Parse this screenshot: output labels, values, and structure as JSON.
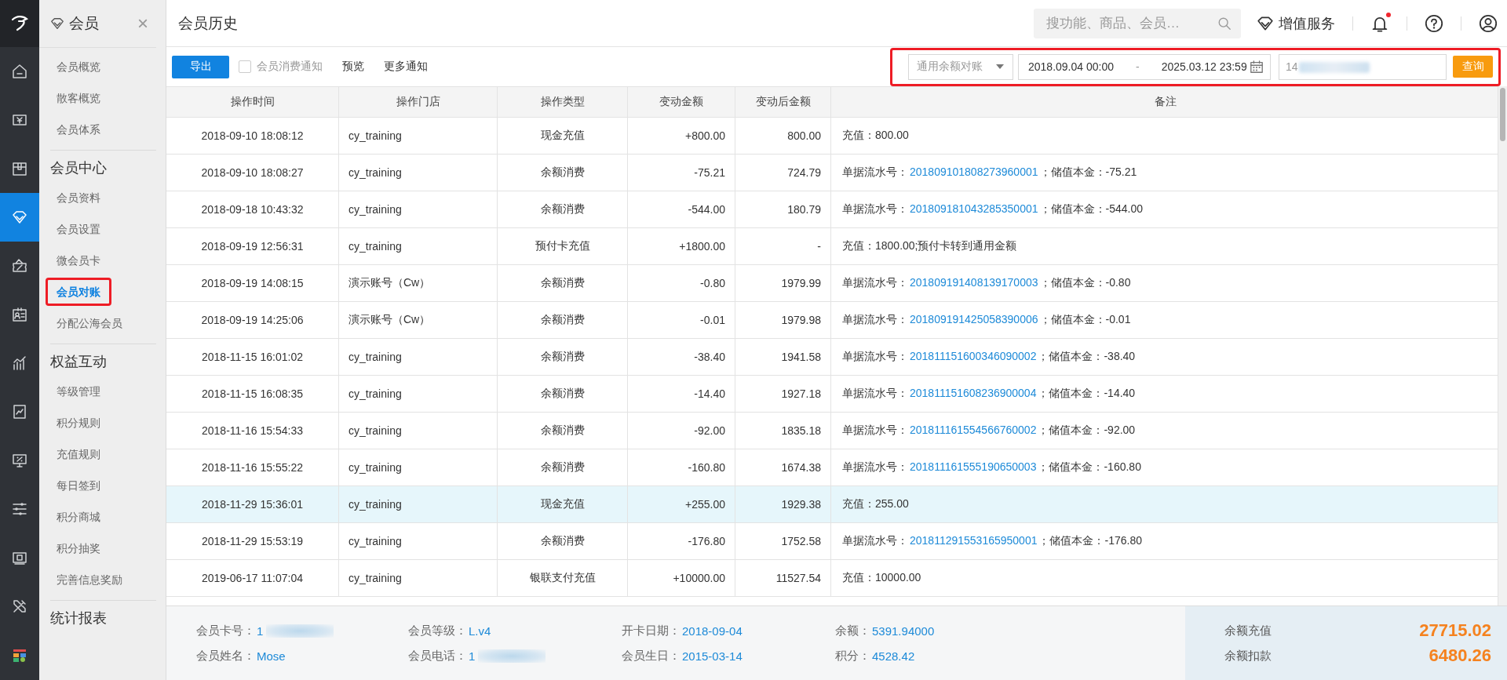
{
  "rail": {
    "items": [
      {
        "selected": false
      },
      {
        "selected": false
      },
      {
        "selected": false
      },
      {
        "selected": true
      },
      {
        "selected": false
      },
      {
        "selected": false
      },
      {
        "selected": false
      },
      {
        "selected": false
      },
      {
        "selected": false
      },
      {
        "selected": false
      },
      {
        "selected": false
      },
      {
        "selected": false
      },
      {
        "selected": false
      }
    ]
  },
  "sidebar": {
    "title": "会员",
    "close": "×",
    "groups": [
      {
        "items": [
          {
            "label": "会员概览",
            "selected": false,
            "highlighted": false
          },
          {
            "label": "散客概览",
            "selected": false,
            "highlighted": false
          },
          {
            "label": "会员体系",
            "selected": false,
            "highlighted": false
          }
        ]
      },
      {
        "heading": "会员中心",
        "items": [
          {
            "label": "会员资料",
            "selected": false,
            "highlighted": false
          },
          {
            "label": "会员设置",
            "selected": false,
            "highlighted": false
          },
          {
            "label": "微会员卡",
            "selected": false,
            "highlighted": false
          },
          {
            "label": "会员对账",
            "selected": true,
            "highlighted": true
          },
          {
            "label": "分配公海会员",
            "selected": false,
            "highlighted": false
          }
        ]
      },
      {
        "heading": "权益互动",
        "items": [
          {
            "label": "等级管理",
            "selected": false,
            "highlighted": false
          },
          {
            "label": "积分规则",
            "selected": false,
            "highlighted": false
          },
          {
            "label": "充值规则",
            "selected": false,
            "highlighted": false
          },
          {
            "label": "每日签到",
            "selected": false,
            "highlighted": false
          },
          {
            "label": "积分商城",
            "selected": false,
            "highlighted": false
          },
          {
            "label": "积分抽奖",
            "selected": false,
            "highlighted": false
          },
          {
            "label": "完善信息奖励",
            "selected": false,
            "highlighted": false
          }
        ]
      },
      {
        "heading": "统计报表"
      }
    ]
  },
  "header": {
    "title": "会员历史",
    "search": {
      "placeholder": "搜功能、商品、会员…"
    },
    "value_added": "增值服务",
    "notification_dot": true
  },
  "toolbar": {
    "export": "导出",
    "notify": {
      "label": "会员消费通知",
      "checked": false
    },
    "links": [
      "预览",
      "更多通知"
    ]
  },
  "filter": {
    "highlighted": true,
    "type": "通用余额对账",
    "date_from": "2018.09.04 00:00",
    "date_sep": "-",
    "date_to": "2025.03.12 23:59",
    "member": {
      "value": "14",
      "redacted": true
    },
    "query": "查询"
  },
  "table": {
    "columns": [
      "操作时间",
      "操作门店",
      "操作类型",
      "变动金额",
      "变动后金额",
      "备注"
    ],
    "rows": [
      {
        "selected": false,
        "cells": [
          "2018-09-10 18:08:12",
          "cy_training",
          "现金充值",
          "+800.00",
          "800.00"
        ],
        "remark": {
          "kind": "text",
          "text": "充值：800.00"
        }
      },
      {
        "selected": false,
        "cells": [
          "2018-09-10 18:08:27",
          "cy_training",
          "余额消费",
          "-75.21",
          "724.79"
        ],
        "remark": {
          "kind": "order",
          "label": "单据流水号：",
          "order_no": "201809101808273960001",
          "tail": "；储值本金：-75.21"
        }
      },
      {
        "selected": false,
        "cells": [
          "2018-09-18 10:43:32",
          "cy_training",
          "余额消费",
          "-544.00",
          "180.79"
        ],
        "remark": {
          "kind": "order",
          "label": "单据流水号：",
          "order_no": "201809181043285350001",
          "tail": "；储值本金：-544.00"
        }
      },
      {
        "selected": false,
        "cells": [
          "2018-09-19 12:56:31",
          "cy_training",
          "预付卡充值",
          "+1800.00",
          "-"
        ],
        "remark": {
          "kind": "text",
          "text": "充值：1800.00;预付卡转到通用金额"
        }
      },
      {
        "selected": false,
        "cells": [
          "2018-09-19 14:08:15",
          "演示账号（Cw）",
          "余额消费",
          "-0.80",
          "1979.99"
        ],
        "remark": {
          "kind": "order",
          "label": "单据流水号：",
          "order_no": "201809191408139170003",
          "tail": "；储值本金：-0.80"
        }
      },
      {
        "selected": false,
        "cells": [
          "2018-09-19 14:25:06",
          "演示账号（Cw）",
          "余额消费",
          "-0.01",
          "1979.98"
        ],
        "remark": {
          "kind": "order",
          "label": "单据流水号：",
          "order_no": "201809191425058390006",
          "tail": "；储值本金：-0.01"
        }
      },
      {
        "selected": false,
        "cells": [
          "2018-11-15 16:01:02",
          "cy_training",
          "余额消费",
          "-38.40",
          "1941.58"
        ],
        "remark": {
          "kind": "order",
          "label": "单据流水号：",
          "order_no": "201811151600346090002",
          "tail": "；储值本金：-38.40"
        }
      },
      {
        "selected": false,
        "cells": [
          "2018-11-15 16:08:35",
          "cy_training",
          "余额消费",
          "-14.40",
          "1927.18"
        ],
        "remark": {
          "kind": "order",
          "label": "单据流水号：",
          "order_no": "201811151608236900004",
          "tail": "；储值本金：-14.40"
        }
      },
      {
        "selected": false,
        "cells": [
          "2018-11-16 15:54:33",
          "cy_training",
          "余额消费",
          "-92.00",
          "1835.18"
        ],
        "remark": {
          "kind": "order",
          "label": "单据流水号：",
          "order_no": "201811161554566760002",
          "tail": "；储值本金：-92.00"
        }
      },
      {
        "selected": false,
        "cells": [
          "2018-11-16 15:55:22",
          "cy_training",
          "余额消费",
          "-160.80",
          "1674.38"
        ],
        "remark": {
          "kind": "order",
          "label": "单据流水号：",
          "order_no": "201811161555190650003",
          "tail": "；储值本金：-160.80"
        }
      },
      {
        "selected": true,
        "cells": [
          "2018-11-29 15:36:01",
          "cy_training",
          "现金充值",
          "+255.00",
          "1929.38"
        ],
        "remark": {
          "kind": "text",
          "text": "充值：255.00"
        }
      },
      {
        "selected": false,
        "cells": [
          "2018-11-29 15:53:19",
          "cy_training",
          "余额消费",
          "-176.80",
          "1752.58"
        ],
        "remark": {
          "kind": "order",
          "label": "单据流水号：",
          "order_no": "201811291553165950001",
          "tail": "；储值本金：-176.80"
        }
      },
      {
        "selected": false,
        "cells": [
          "2019-06-17 11:07:04",
          "cy_training",
          "银联支付充值",
          "+10000.00",
          "11527.54"
        ],
        "remark": {
          "kind": "text",
          "text": "充值：10000.00"
        }
      }
    ]
  },
  "member_info": {
    "fields": [
      {
        "label": "会员卡号：",
        "value": "1",
        "redacted": true
      },
      {
        "label": "会员等级：",
        "value": "L.v4",
        "redacted": false
      },
      {
        "label": "开卡日期：",
        "value": "2018-09-04",
        "redacted": false
      },
      {
        "label": "余额：",
        "value": "5391.94000",
        "redacted": false
      },
      {
        "label": "会员姓名：",
        "value": "Mose",
        "redacted": false
      },
      {
        "label": "会员电话：",
        "value": "1",
        "redacted": true
      },
      {
        "label": "会员生日：",
        "value": "2015-03-14",
        "redacted": false
      },
      {
        "label": "积分：",
        "value": "4528.42",
        "redacted": false
      }
    ],
    "totals": [
      {
        "label": "余额充值",
        "value": "27715.02"
      },
      {
        "label": "余额扣款",
        "value": "6480.26"
      }
    ]
  }
}
